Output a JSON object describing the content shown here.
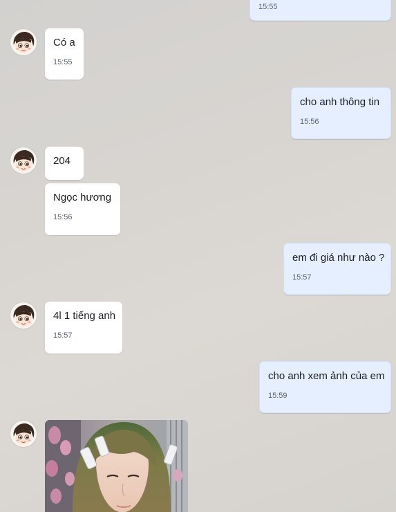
{
  "messages": [
    {
      "direction": "out",
      "text": "",
      "time": "15:55"
    },
    {
      "direction": "in",
      "text": "Có a",
      "time": "15:55"
    },
    {
      "direction": "out",
      "text": "cho anh thông tin",
      "time": "15:56"
    },
    {
      "direction": "in",
      "text": "204",
      "time": ""
    },
    {
      "direction": "in",
      "text": "Ngọc hương",
      "time": "15:56"
    },
    {
      "direction": "out",
      "text": "em đi giá như nào ?",
      "time": "15:57"
    },
    {
      "direction": "in",
      "text": "4l 1 tiếng anh",
      "time": "15:57"
    },
    {
      "direction": "out",
      "text": "cho anh xem ảnh của em",
      "time": "15:59"
    },
    {
      "direction": "in",
      "type": "image",
      "image": "photo-of-girl-with-hair-clips"
    }
  ],
  "avatar": {
    "icon": "cartoon-face-avatar"
  },
  "colors": {
    "incoming_bubble": "#ffffff",
    "outgoing_bubble": "#e5efff",
    "text": "#1c1e21",
    "time": "#5b6470",
    "background": "#d6d3cf"
  }
}
